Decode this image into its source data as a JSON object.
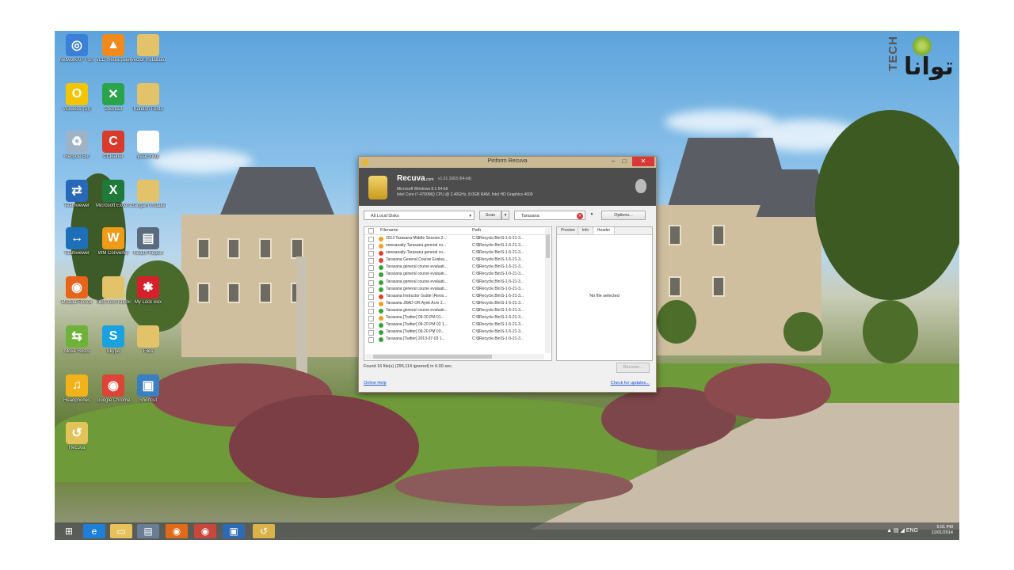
{
  "watermark": {
    "latin": "TECH",
    "arabic": "توانا"
  },
  "desktop_icons": [
    {
      "label": "NetworkXP - Shortcut...",
      "icon": "network-icon",
      "color": "#3c7fd6",
      "glyph": "◎"
    },
    {
      "label": "VLC media player",
      "icon": "vlc-icon",
      "color": "#f08a1c",
      "glyph": "▲"
    },
    {
      "label": "Vector Installation...",
      "icon": "folder-icon",
      "color": "#e3c36a",
      "glyph": ""
    },
    {
      "label": "Wireless (UI)",
      "icon": "wireless-icon",
      "color": "#f2c500",
      "glyph": "O"
    },
    {
      "label": "Shortcut",
      "icon": "app-icon",
      "color": "#2aa34a",
      "glyph": "✕"
    },
    {
      "label": "Kurdish Fonts",
      "icon": "folder-icon",
      "color": "#e3c36a",
      "glyph": ""
    },
    {
      "label": "Recycle Bin",
      "icon": "recycle-bin-icon",
      "color": "#9fb3c8",
      "glyph": "♻"
    },
    {
      "label": "CCleaner",
      "icon": "ccleaner-icon",
      "color": "#d83b2b",
      "glyph": "C"
    },
    {
      "label": "yelaronsty",
      "icon": "document-icon",
      "color": "#ffffff",
      "glyph": ""
    },
    {
      "label": "Teamviewer",
      "icon": "teamviewer-icon",
      "color": "#2868b8",
      "glyph": "⇄"
    },
    {
      "label": "Microsoft Excel 2010",
      "icon": "excel-icon",
      "color": "#1f7a3a",
      "glyph": "X"
    },
    {
      "label": "Gangam Installer",
      "icon": "folder-icon",
      "color": "#e3c36a",
      "glyph": ""
    },
    {
      "label": "Teamviewer",
      "icon": "teamviewer-icon",
      "color": "#1d6fb8",
      "glyph": "↔"
    },
    {
      "label": "WM Converter",
      "icon": "converter-icon",
      "color": "#f09a1a",
      "glyph": "W"
    },
    {
      "label": "Health Report",
      "icon": "report-icon",
      "color": "#5a6b80",
      "glyph": "▤"
    },
    {
      "label": "Mozilla Firefox",
      "icon": "firefox-icon",
      "color": "#e8641b",
      "glyph": "◉"
    },
    {
      "label": "Files from Kurdish...",
      "icon": "folder-icon",
      "color": "#e3c36a",
      "glyph": ""
    },
    {
      "label": "My Lock Box",
      "icon": "lockbox-icon",
      "color": "#d8202a",
      "glyph": "✱"
    },
    {
      "label": "Move Hosts",
      "icon": "move-icon",
      "color": "#6fb23a",
      "glyph": "⇆"
    },
    {
      "label": "Skype",
      "icon": "skype-icon",
      "color": "#1aa1e0",
      "glyph": "S"
    },
    {
      "label": "Files",
      "icon": "files-icon",
      "color": "#e3c36a",
      "glyph": ""
    },
    {
      "label": "Headphones",
      "icon": "headphones-icon",
      "color": "#f2b21a",
      "glyph": "♫"
    },
    {
      "label": "Google Chrome",
      "icon": "chrome-icon",
      "color": "#db4437",
      "glyph": "◉"
    },
    {
      "label": "Shortcut",
      "icon": "monitor-icon",
      "color": "#3a7fc2",
      "glyph": "▣"
    },
    {
      "label": "Recuva",
      "icon": "recuva-icon",
      "color": "#e2c35a",
      "glyph": "↺"
    }
  ],
  "recuva": {
    "title": "Piriform Recuva",
    "controls": {
      "minimize": "–",
      "maximize": "□",
      "close": "✕"
    },
    "app_name": "Recuva",
    "app_domain": ".com",
    "version": "v1.51.1063 (64-bit)",
    "os_info": "Microsoft Windows 8.1 64-bit",
    "hw_info": "Intel Core i7-4700MQ CPU @ 2.40GHz, 8.0GB RAM, Intel HD Graphics 4600",
    "toolbar": {
      "drive": "All Local Disks",
      "scan": "Scan",
      "search": "Tarasana",
      "options": "Options..."
    },
    "columns": {
      "filename": "Filename",
      "path": "Path"
    },
    "files": [
      {
        "name": "2013 Tarasana Middle Session 2...",
        "path": "C:\\$Recycle.Bin\\S-1-5-21-3...",
        "state": "#f0a020"
      },
      {
        "name": "newsanaity-Tarasana general co...",
        "path": "C:\\$Recycle.Bin\\S-1-5-21-3...",
        "state": "#f0a020"
      },
      {
        "name": "newsanaity-Tarasana general co...",
        "path": "C:\\$Recycle.Bin\\S-1-5-21-3...",
        "state": "#e04030"
      },
      {
        "name": "Tarasana General Course Evalua...",
        "path": "C:\\$Recycle.Bin\\S-1-5-21-3...",
        "state": "#e04030"
      },
      {
        "name": "Tarasana general course evaluati...",
        "path": "C:\\$Recycle.Bin\\S-1-5-21-3...",
        "state": "#3aa13a"
      },
      {
        "name": "Tarasana general course evaluati...",
        "path": "C:\\$Recycle.Bin\\S-1-5-21-3...",
        "state": "#3aa13a"
      },
      {
        "name": "Tarasana general course evaluati...",
        "path": "C:\\$Recycle.Bin\\S-1-5-21-3...",
        "state": "#3aa13a"
      },
      {
        "name": "Tarasana general course evaluati...",
        "path": "C:\\$Recycle.Bin\\S-1-5-21-3...",
        "state": "#3aa13a"
      },
      {
        "name": "Tarasana Instructor Guide (Revis...",
        "path": "C:\\$Recycle.Bin\\S-1-5-21-3...",
        "state": "#e04030"
      },
      {
        "name": "Tarasana JBAD OR Ayeb Acre 2...",
        "path": "C:\\$Recycle.Bin\\S-1-5-21-3...",
        "state": "#f0a020"
      },
      {
        "name": "Tarasana general course evaluati...",
        "path": "C:\\$Recycle.Bin\\S-1-5-21-3...",
        "state": "#3aa13a"
      },
      {
        "name": "Tarasana [Twitter] 09-20 PM 01...",
        "path": "C:\\$Recycle.Bin\\S-1-5-21-3...",
        "state": "#f0a020"
      },
      {
        "name": "Tarasana [Twitter] 09-20 PM 02 1...",
        "path": "C:\\$Recycle.Bin\\S-1-5-21-3...",
        "state": "#3aa13a"
      },
      {
        "name": "Tarasana [Twitter] 09-20 PM 03...",
        "path": "C:\\$Recycle.Bin\\S-1-5-21-3...",
        "state": "#3aa13a"
      },
      {
        "name": "Tarasana [Twitter] 2013-07-03 1...",
        "path": "C:\\$Recycle.Bin\\S-1-5-21-3...",
        "state": "#3aa13a"
      }
    ],
    "preview_tabs": [
      "Preview",
      "Info",
      "Header"
    ],
    "active_tab": 2,
    "no_file_text": "No file selected",
    "status": "Found 16 file(s) (295,114 ignored) in 6.00 sec.",
    "recover": "Recover...",
    "online_help": "Online Help",
    "check_updates": "Check for updates..."
  },
  "taskbar": {
    "items": [
      {
        "name": "start-button",
        "glyph": "⊞",
        "color": "transparent"
      },
      {
        "name": "taskbar-ie",
        "glyph": "e",
        "color": "#1e7fd4"
      },
      {
        "name": "taskbar-explorer",
        "glyph": "▭",
        "color": "#e7c25a"
      },
      {
        "name": "taskbar-app",
        "glyph": "▤",
        "color": "#6a7d94"
      },
      {
        "name": "taskbar-firefox",
        "glyph": "◉",
        "color": "#e06a1a"
      },
      {
        "name": "taskbar-chrome",
        "glyph": "◉",
        "color": "#c8463a"
      },
      {
        "name": "taskbar-teamviewer",
        "glyph": "▣",
        "color": "#2d6cb4"
      },
      {
        "name": "taskbar-recuva",
        "glyph": "↺",
        "color": "#d9b347"
      }
    ],
    "tray_icons": "▲ ▤ ◢ ENG",
    "time": "5:01 PM",
    "date": "11/01/2014"
  }
}
